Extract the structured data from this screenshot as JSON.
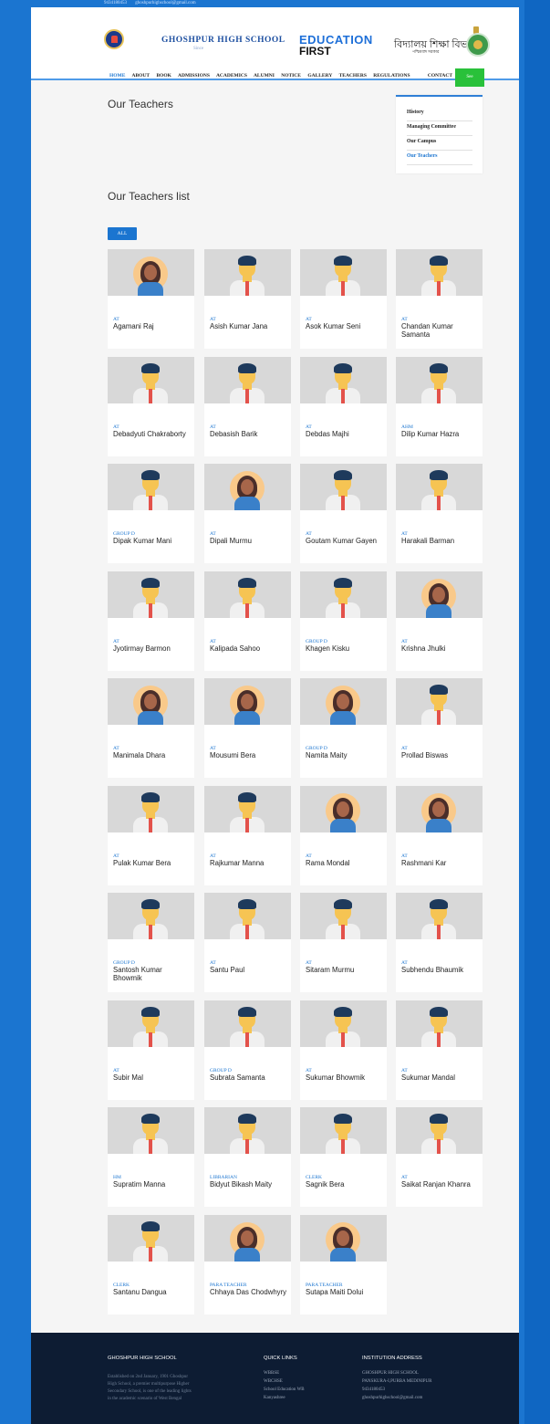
{
  "topbar": {
    "phone": "9434180453",
    "email": "ghoshpurhighschool@gmail.com"
  },
  "header": {
    "school_name": "GHOSHPUR HIGH SCHOOL",
    "since": "Since",
    "edu_line1": "EDUCATION",
    "edu_line2": "FIRST",
    "dept": "বিদ্যালয় শিক্ষা বিভাগ",
    "dept_sub": "পশ্চিমবঙ্গ সরকার"
  },
  "nav": {
    "items": [
      "HOME",
      "ABOUT",
      "BOOK",
      "ADMISSIONS",
      "ACADEMICS",
      "ALUMNI",
      "NOTICE",
      "GALLERY",
      "TEACHERS",
      "REGULATIONS",
      "CONTACT"
    ],
    "see_label": "See"
  },
  "page_title": "Our Teachers",
  "side_menu": [
    "History",
    "Managing Committee",
    "Our Campus",
    "Our Teachers"
  ],
  "list_title": "Our Teachers list",
  "filter_all": "ALL",
  "teachers": [
    {
      "role": "AT",
      "name": "Agamani Raj",
      "avatar": "female"
    },
    {
      "role": "AT",
      "name": "Asish Kumar Jana",
      "avatar": "male"
    },
    {
      "role": "AT",
      "name": "Asok Kumar Seni",
      "avatar": "male"
    },
    {
      "role": "AT",
      "name": "Chandan Kumar Samanta",
      "avatar": "male"
    },
    {
      "role": "AT",
      "name": "Debadyuti Chakraborty",
      "avatar": "male"
    },
    {
      "role": "AT",
      "name": "Debasish Barik",
      "avatar": "male"
    },
    {
      "role": "AT",
      "name": "Debdas Majhi",
      "avatar": "male"
    },
    {
      "role": "AHM",
      "name": "Dilip Kumar Hazra",
      "avatar": "male"
    },
    {
      "role": "GROUP D",
      "name": "Dipak Kumar Mani",
      "avatar": "male"
    },
    {
      "role": "AT",
      "name": "Dipali Murmu",
      "avatar": "female"
    },
    {
      "role": "AT",
      "name": "Goutam Kumar Gayen",
      "avatar": "male"
    },
    {
      "role": "AT",
      "name": "Harakali Barman",
      "avatar": "male"
    },
    {
      "role": "AT",
      "name": "Jyotirmay Barmon",
      "avatar": "male"
    },
    {
      "role": "AT",
      "name": "Kalipada Sahoo",
      "avatar": "male"
    },
    {
      "role": "GROUP D",
      "name": "Khagen Kisku",
      "avatar": "male"
    },
    {
      "role": "AT",
      "name": "Krishna Jhulki",
      "avatar": "female"
    },
    {
      "role": "AT",
      "name": "Manimala Dhara",
      "avatar": "female"
    },
    {
      "role": "AT",
      "name": "Mousumi Bera",
      "avatar": "female"
    },
    {
      "role": "GROUP D",
      "name": "Namita Maity",
      "avatar": "female"
    },
    {
      "role": "AT",
      "name": "Prollad Biswas",
      "avatar": "male"
    },
    {
      "role": "AT",
      "name": "Pulak Kumar Bera",
      "avatar": "male"
    },
    {
      "role": "AT",
      "name": "Rajkumar Manna",
      "avatar": "male"
    },
    {
      "role": "AT",
      "name": "Rama Mondal",
      "avatar": "female"
    },
    {
      "role": "AT",
      "name": "Rashmani Kar",
      "avatar": "female"
    },
    {
      "role": "GROUP D",
      "name": "Santosh Kumar Bhowmik",
      "avatar": "male"
    },
    {
      "role": "AT",
      "name": "Santu Paul",
      "avatar": "male"
    },
    {
      "role": "AT",
      "name": "Sitaram Murmu",
      "avatar": "male"
    },
    {
      "role": "AT",
      "name": "Subhendu Bhaumik",
      "avatar": "male"
    },
    {
      "role": "AT",
      "name": "Subir Mal",
      "avatar": "male"
    },
    {
      "role": "GROUP D",
      "name": "Subrata Samanta",
      "avatar": "male"
    },
    {
      "role": "AT",
      "name": "Sukumar Bhowmik",
      "avatar": "male"
    },
    {
      "role": "AT",
      "name": "Sukumar Mandal",
      "avatar": "male"
    },
    {
      "role": "HM",
      "name": "Supratim Manna",
      "avatar": "male"
    },
    {
      "role": "LIBRARIAN",
      "name": "Bidyut Bikash Maity",
      "avatar": "male"
    },
    {
      "role": "CLERK",
      "name": "Sagnik Bera",
      "avatar": "male"
    },
    {
      "role": "AT",
      "name": "Saikat Ranjan Khanra",
      "avatar": "male"
    },
    {
      "role": "CLERK",
      "name": "Santanu Dangua",
      "avatar": "male"
    },
    {
      "role": "PARA TEACHER",
      "name": "Chhaya Das Chodwhyry",
      "avatar": "female"
    },
    {
      "role": "PARA TEACHER",
      "name": "Sutapa Maiti Dolui",
      "avatar": "female"
    }
  ],
  "footer": {
    "school_heading": "GHOSHPUR HIGH SCHOOL",
    "about_lines": [
      "Established on 2nd January, 1901 Ghoshpur",
      "High School, a premier multipurpose Higher",
      "Secondary School, is one of the leading lights",
      "in the academic scenario of West Bengal"
    ],
    "quick_heading": "QUICK LINKS",
    "quick_links": [
      "WBBSE",
      "WBCHSE",
      "School Education WB",
      "Kanyashree"
    ],
    "address_heading": "INSTITUTION ADDRESS",
    "address_lines": [
      "GHOSHPUR HIGH SCHOOL",
      "PANSKURA-I,PURBA MEDINIPUR",
      "9434180453",
      "ghoshpurhighschool@gmail.com"
    ]
  },
  "colors": {
    "accent": "#1b75d0",
    "see_button": "#29c13a",
    "footer_bg": "#0d1c33"
  }
}
